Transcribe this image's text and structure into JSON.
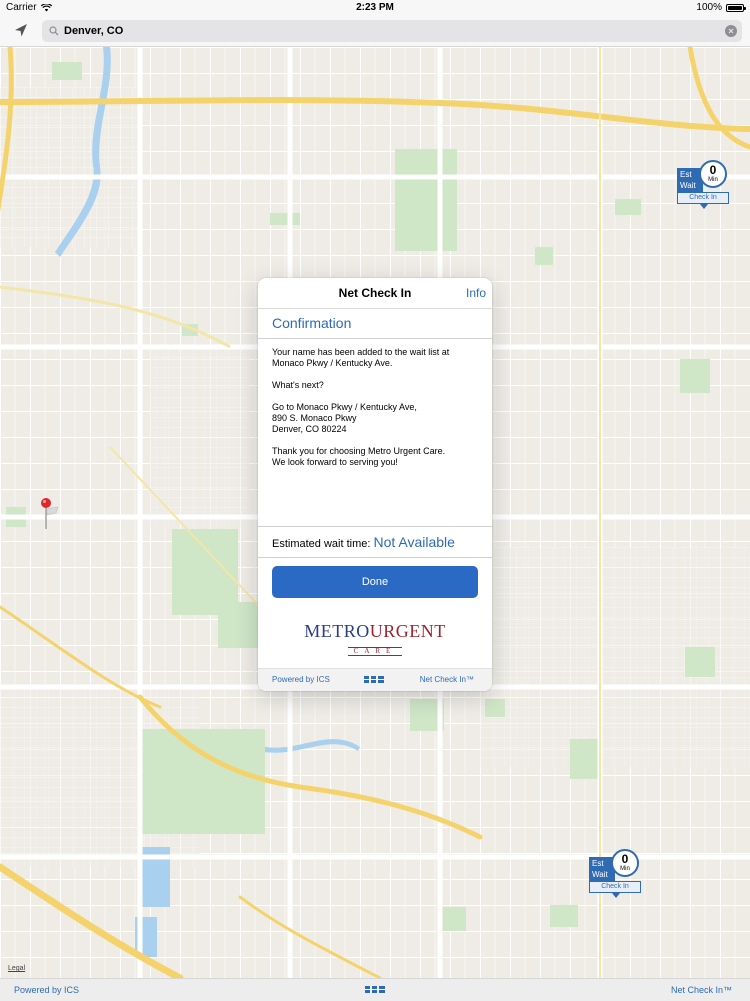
{
  "status_bar": {
    "carrier": "Carrier",
    "time": "2:23 PM",
    "battery": "100%"
  },
  "search": {
    "value": "Denver, CO",
    "placeholder": "Search"
  },
  "map": {
    "legal_label": "Legal"
  },
  "markers": [
    {
      "est_label": "Est",
      "wait_label": "Wait",
      "minutes": "0",
      "unit": "Min",
      "checkin_label": "Check In"
    },
    {
      "est_label": "Est",
      "wait_label": "Wait",
      "minutes": "0",
      "unit": "Min",
      "checkin_label": "Check In"
    }
  ],
  "modal": {
    "title": "Net Check In",
    "info_label": "Info",
    "section_title": "Confirmation",
    "message": {
      "line1": "Your name has been added to the wait list at",
      "line2": "Monaco Pkwy / Kentucky Ave.",
      "next_heading": "What's next?",
      "addr1": "Go to Monaco Pkwy / Kentucky Ave,",
      "addr2": "890 S. Monaco Pkwy",
      "addr3": "Denver, CO 80224",
      "thanks1": "Thank you for choosing Metro Urgent Care.",
      "thanks2": "We look forward to serving you!"
    },
    "wait_label": "Estimated wait time:",
    "wait_value": "Not Available",
    "done_label": "Done",
    "logo": {
      "metro": "METRO",
      "urgent": "URGENT",
      "care": "CARE"
    },
    "footer": {
      "powered_by": "Powered by ICS",
      "product": "Net Check In™"
    }
  },
  "bottom_bar": {
    "powered_by": "Powered by ICS",
    "product": "Net Check In™"
  },
  "colors": {
    "accent": "#2f6bb3",
    "button": "#2b6ac4",
    "logo_blue": "#2a3e86",
    "logo_red": "#9a2531"
  }
}
